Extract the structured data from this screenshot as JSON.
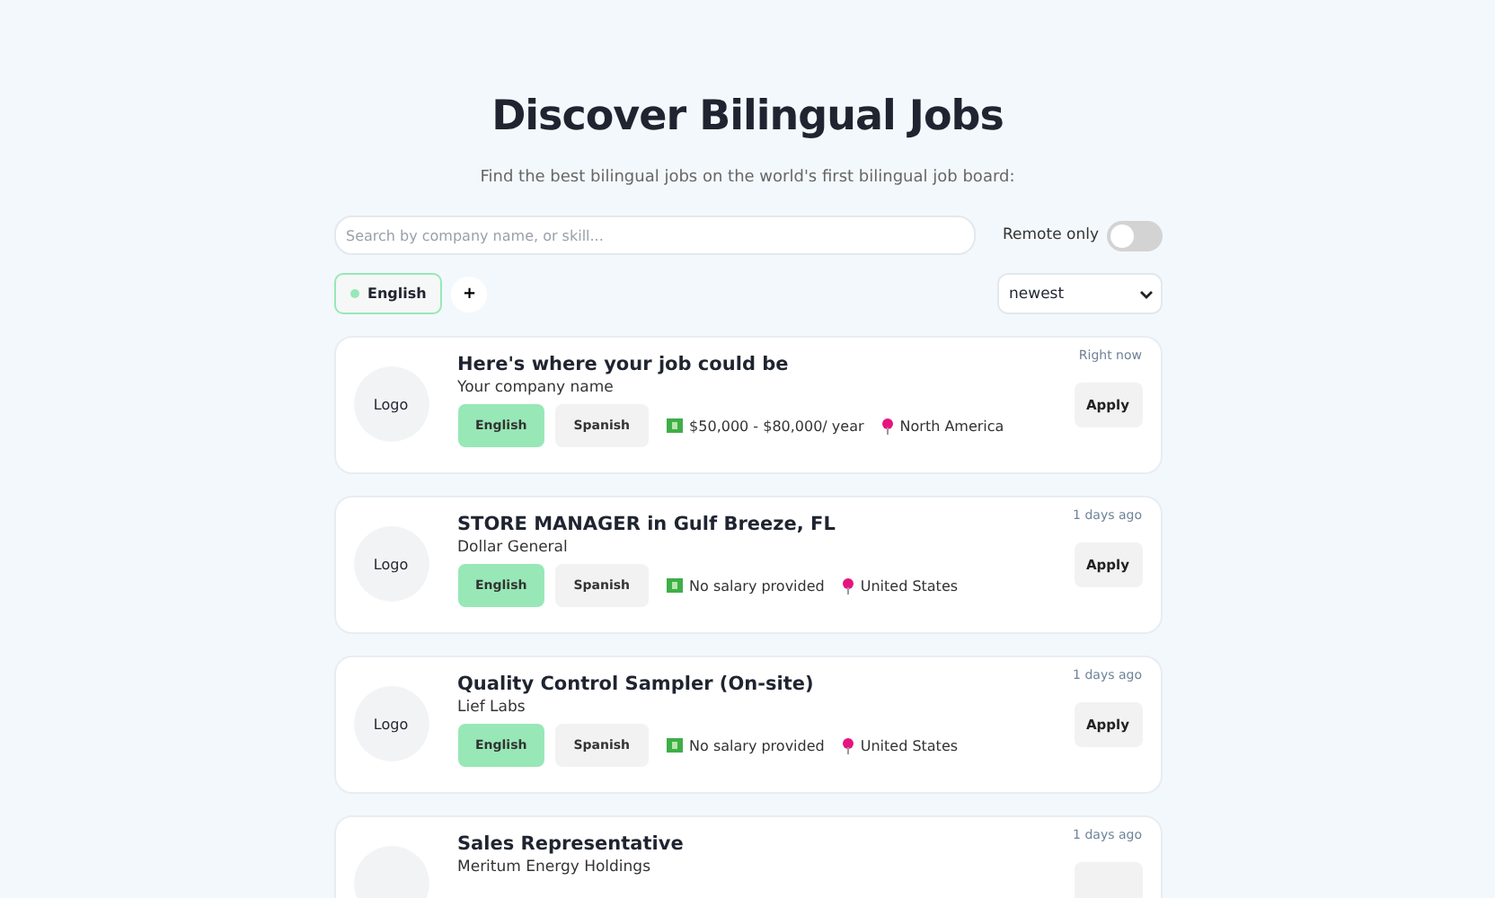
{
  "header": {
    "title": "Discover Bilingual Jobs",
    "subtitle": "Find the best bilingual jobs on the world's first bilingual job board:"
  },
  "search": {
    "placeholder": "Search by company name, or skill..."
  },
  "remote": {
    "label": "Remote only",
    "on": false
  },
  "language_filters": [
    {
      "label": "English",
      "color": "#97e8b6"
    }
  ],
  "add_filter": "+",
  "sort": {
    "value": "newest"
  },
  "jobs": [
    {
      "logo": "Logo",
      "title": "Here's where your job could be",
      "company": "Your company name",
      "time": "Right now",
      "apply": "Apply",
      "tags": [
        {
          "label": "English",
          "selected": true
        },
        {
          "label": "Spanish",
          "selected": false
        }
      ],
      "salary": "$50,000 - $80,000/ year",
      "location": "North America"
    },
    {
      "logo": "Logo",
      "title": "STORE MANAGER in Gulf Breeze, FL",
      "company": "Dollar General",
      "time": "1 days ago",
      "apply": "Apply",
      "tags": [
        {
          "label": "English",
          "selected": true
        },
        {
          "label": "Spanish",
          "selected": false
        }
      ],
      "salary": "No salary provided",
      "location": "United States"
    },
    {
      "logo": "Logo",
      "title": "Quality Control Sampler (On-site)",
      "company": "Lief Labs",
      "time": "1 days ago",
      "apply": "Apply",
      "tags": [
        {
          "label": "English",
          "selected": true
        },
        {
          "label": "Spanish",
          "selected": false
        }
      ],
      "salary": "No salary provided",
      "location": "United States"
    },
    {
      "title": "Sales Representative",
      "company": "Meritum Energy Holdings",
      "time": "1 days ago"
    }
  ]
}
